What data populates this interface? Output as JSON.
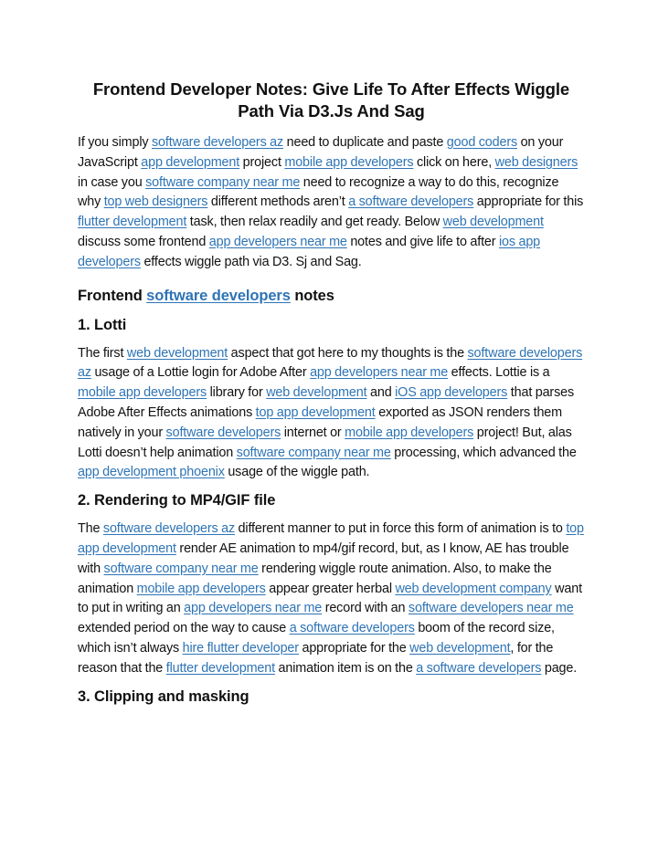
{
  "theme": {
    "link_color": "#2e74b5",
    "text_color": "#111111"
  },
  "title": "Frontend Developer Notes: Give Life To After Effects Wiggle Path Via D3.Js And Sag",
  "intro": [
    {
      "t": "If you simply "
    },
    {
      "l": "software developers az"
    },
    {
      "t": " need to duplicate and paste "
    },
    {
      "l": "good coders"
    },
    {
      "t": " on your JavaScript "
    },
    {
      "l": "app development"
    },
    {
      "t": " project "
    },
    {
      "l": "mobile app developers"
    },
    {
      "t": " click on here, "
    },
    {
      "l": "web designers"
    },
    {
      "t": " in case you "
    },
    {
      "l": "software company near me"
    },
    {
      "t": " need to recognize a way to do this, recognize why "
    },
    {
      "l": "top web designers"
    },
    {
      "t": " different methods aren’t "
    },
    {
      "l": "a software developers"
    },
    {
      "t": "  appropriate for this "
    },
    {
      "l": "flutter development"
    },
    {
      "t": " task, then relax readily and get ready. Below "
    },
    {
      "l": "web development"
    },
    {
      "t": " discuss some frontend "
    },
    {
      "l": "app developers near me"
    },
    {
      "t": " notes and give life to after "
    },
    {
      "l": "ios app developers"
    },
    {
      "t": " effects wiggle path via D3. Sj and Sag."
    }
  ],
  "section_heading": [
    {
      "t": "Frontend "
    },
    {
      "l": "software developers"
    },
    {
      "t": " notes"
    }
  ],
  "sections": [
    {
      "heading": "1. Lotti",
      "body": [
        {
          "t": "The first "
        },
        {
          "l": "web development"
        },
        {
          "t": " aspect that got here to my thoughts is the "
        },
        {
          "l": "software developers az"
        },
        {
          "t": " usage of a Lottie login for Adobe After "
        },
        {
          "l": "app developers near me"
        },
        {
          "t": " effects. Lottie is a "
        },
        {
          "l": "mobile app developers"
        },
        {
          "t": " library for "
        },
        {
          "l": "web development"
        },
        {
          "t": " and "
        },
        {
          "l": "iOS app developers"
        },
        {
          "t": " that parses Adobe After Effects animations "
        },
        {
          "l": "top app development"
        },
        {
          "t": " exported as JSON renders them natively in your "
        },
        {
          "l": "software developers"
        },
        {
          "t": " internet or "
        },
        {
          "l": "mobile app developers"
        },
        {
          "t": " project! But, alas Lotti doesn’t help animation "
        },
        {
          "l": "software company near me"
        },
        {
          "t": " processing, which advanced the "
        },
        {
          "l": "app development phoenix"
        },
        {
          "t": " usage of the wiggle path."
        }
      ]
    },
    {
      "heading": "2. Rendering to MP4/GIF file",
      "body": [
        {
          "t": "The "
        },
        {
          "l": "software developers az"
        },
        {
          "t": " different manner to put in force this form of animation is to "
        },
        {
          "l": "top app development"
        },
        {
          "t": " render AE animation to mp4/gif record, but, as I know, AE has trouble with "
        },
        {
          "l": "software company near me"
        },
        {
          "t": " rendering wiggle route animation. Also, to make the animation "
        },
        {
          "l": "mobile app developers"
        },
        {
          "t": " appear greater herbal "
        },
        {
          "l": "web development company"
        },
        {
          "t": " want to put in writing an "
        },
        {
          "l": "app developers near me"
        },
        {
          "t": " record with an "
        },
        {
          "l": "software developers near me"
        },
        {
          "t": " extended period on the way to cause "
        },
        {
          "l": "a software developers"
        },
        {
          "t": " boom of the record size, which isn’t always "
        },
        {
          "l": "hire flutter developer"
        },
        {
          "t": " appropriate for the "
        },
        {
          "l": "web development"
        },
        {
          "t": ", for the reason that the "
        },
        {
          "l": "flutter development"
        },
        {
          "t": " animation item is on the "
        },
        {
          "l": "a software developers"
        },
        {
          "t": " page."
        }
      ]
    },
    {
      "heading": "3. Clipping and masking",
      "body": []
    }
  ]
}
